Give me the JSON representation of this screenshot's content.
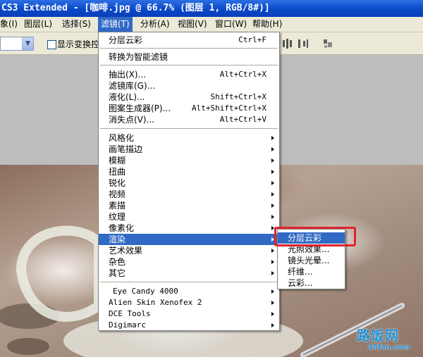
{
  "window": {
    "title": "CS3 Extended - [咖啡.jpg @ 66.7% (图层 1, RGB/8#)]"
  },
  "menubar": {
    "items": [
      {
        "label": "象(I)"
      },
      {
        "label": "图层(L)"
      },
      {
        "label": "选择(S)"
      },
      {
        "label": "滤镜(T)"
      },
      {
        "label": "分析(A)"
      },
      {
        "label": "视图(V)"
      },
      {
        "label": "窗口(W)"
      },
      {
        "label": "帮助(H)"
      }
    ]
  },
  "options": {
    "checkbox_label": "显示变换控"
  },
  "filter_menu": {
    "last_filter": {
      "label": "分层云彩",
      "shortcut": "Ctrl+F"
    },
    "smart_filter": {
      "label": "转换为智能滤镜"
    },
    "tools": [
      {
        "label": "抽出(X)...",
        "shortcut": "Alt+Ctrl+X"
      },
      {
        "label": "滤镜库(G)...",
        "shortcut": ""
      },
      {
        "label": "液化(L)...",
        "shortcut": "Shift+Ctrl+X"
      },
      {
        "label": "图案生成器(P)...",
        "shortcut": "Alt+Shift+Ctrl+X"
      },
      {
        "label": "消失点(V)...",
        "shortcut": "Alt+Ctrl+V"
      }
    ],
    "categories": [
      {
        "label": "风格化"
      },
      {
        "label": "画笔描边"
      },
      {
        "label": "模糊"
      },
      {
        "label": "扭曲"
      },
      {
        "label": "锐化"
      },
      {
        "label": "视频"
      },
      {
        "label": "素描"
      },
      {
        "label": "纹理"
      },
      {
        "label": "像素化"
      },
      {
        "label": "渲染"
      },
      {
        "label": "艺术效果"
      },
      {
        "label": "杂色"
      },
      {
        "label": "其它"
      }
    ],
    "plugins": [
      {
        "label": "Eye Candy 4000"
      },
      {
        "label": "Alien Skin Xenofex 2"
      },
      {
        "label": "DCE Tools"
      },
      {
        "label": "Digimarc"
      }
    ]
  },
  "render_submenu": {
    "items": [
      {
        "label": "分层云彩"
      },
      {
        "label": "光照效果..."
      },
      {
        "label": "镜头光晕..."
      },
      {
        "label": "纤维..."
      },
      {
        "label": "云彩..."
      }
    ]
  },
  "watermark": {
    "title": "路饭网",
    "url": "45fan.com"
  },
  "colors": {
    "highlight": "#316ac5",
    "annotation": "#e0242a",
    "titlebar": "#0a48c9"
  }
}
